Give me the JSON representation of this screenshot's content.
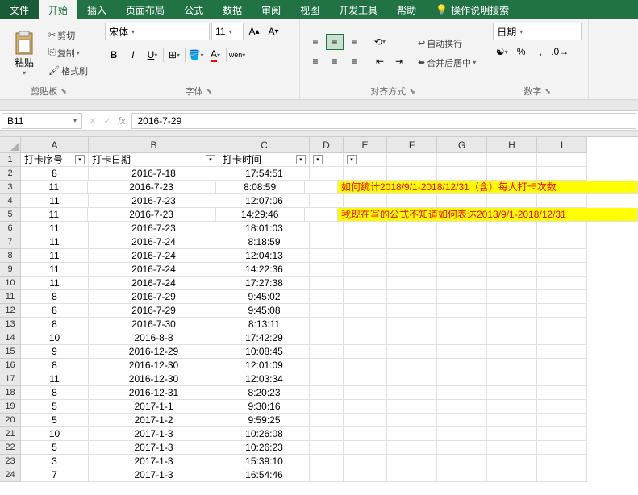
{
  "tabs": {
    "file": "文件",
    "home": "开始",
    "insert": "插入",
    "layout": "页面布局",
    "formula": "公式",
    "data": "数据",
    "review": "审阅",
    "view": "视图",
    "dev": "开发工具",
    "help": "帮助",
    "tellme": "操作说明搜索"
  },
  "ribbon": {
    "clipboard": {
      "label": "剪贴板",
      "paste": "粘贴",
      "cut": "剪切",
      "copy": "复制",
      "format_painter": "格式刷"
    },
    "font": {
      "label": "字体",
      "name": "宋体",
      "size": "11"
    },
    "alignment": {
      "label": "对齐方式",
      "wrap": "自动换行",
      "merge": "合并后居中"
    },
    "number": {
      "label": "数字",
      "format": "日期"
    }
  },
  "name_box": "B11",
  "formula_value": "2016-7-29",
  "columns": [
    "A",
    "B",
    "C",
    "D",
    "E",
    "F",
    "G",
    "H",
    "I"
  ],
  "headers": {
    "a": "打卡序号",
    "b": "打卡日期",
    "c": "打卡时间"
  },
  "notes": {
    "line1": "如何统计2018/9/1-2018/12/31（含）每人打卡次数",
    "line2": "我现在写的公式不知道如何表达2018/9/1-2018/12/31"
  },
  "rows": [
    {
      "n": 1,
      "a": "打卡序号",
      "b": "打卡日期",
      "c": "打卡时间",
      "hdr": true
    },
    {
      "n": 2,
      "a": "8",
      "b": "2016-7-18",
      "c": "17:54:51"
    },
    {
      "n": 3,
      "a": "11",
      "b": "2016-7-23",
      "c": "8:08:59"
    },
    {
      "n": 4,
      "a": "11",
      "b": "2016-7-23",
      "c": "12:07:06"
    },
    {
      "n": 5,
      "a": "11",
      "b": "2016-7-23",
      "c": "14:29:46"
    },
    {
      "n": 6,
      "a": "11",
      "b": "2016-7-23",
      "c": "18:01:03"
    },
    {
      "n": 7,
      "a": "11",
      "b": "2016-7-24",
      "c": "8:18:59"
    },
    {
      "n": 8,
      "a": "11",
      "b": "2016-7-24",
      "c": "12:04:13"
    },
    {
      "n": 9,
      "a": "11",
      "b": "2016-7-24",
      "c": "14:22:36"
    },
    {
      "n": 10,
      "a": "11",
      "b": "2016-7-24",
      "c": "17:27:38"
    },
    {
      "n": 11,
      "a": "8",
      "b": "2016-7-29",
      "c": "9:45:02"
    },
    {
      "n": 12,
      "a": "8",
      "b": "2016-7-29",
      "c": "9:45:08"
    },
    {
      "n": 13,
      "a": "8",
      "b": "2016-7-30",
      "c": "8:13:11"
    },
    {
      "n": 14,
      "a": "10",
      "b": "2016-8-8",
      "c": "17:42:29"
    },
    {
      "n": 15,
      "a": "9",
      "b": "2016-12-29",
      "c": "10:08:45"
    },
    {
      "n": 16,
      "a": "8",
      "b": "2016-12-30",
      "c": "12:01:09"
    },
    {
      "n": 17,
      "a": "11",
      "b": "2016-12-30",
      "c": "12:03:34"
    },
    {
      "n": 18,
      "a": "8",
      "b": "2016-12-31",
      "c": "8:20:23"
    },
    {
      "n": 19,
      "a": "5",
      "b": "2017-1-1",
      "c": "9:30:16"
    },
    {
      "n": 20,
      "a": "5",
      "b": "2017-1-2",
      "c": "9:59:25"
    },
    {
      "n": 21,
      "a": "10",
      "b": "2017-1-3",
      "c": "10:26:08"
    },
    {
      "n": 22,
      "a": "5",
      "b": "2017-1-3",
      "c": "10:26:23"
    },
    {
      "n": 23,
      "a": "3",
      "b": "2017-1-3",
      "c": "15:39:10"
    },
    {
      "n": 24,
      "a": "7",
      "b": "2017-1-3",
      "c": "16:54:46"
    }
  ]
}
